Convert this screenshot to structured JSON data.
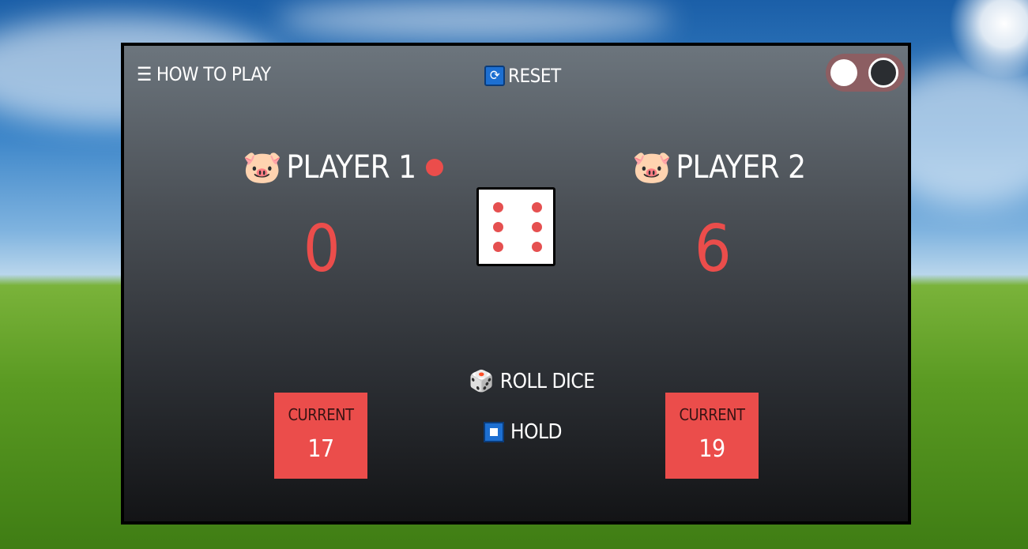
{
  "header": {
    "how_to_play_icon": "☰",
    "how_to_play": "HOW TO PLAY",
    "reset_icon": "🔄",
    "reset": "RESET"
  },
  "players": [
    {
      "icon": "🐷",
      "name": "PLAYER 1",
      "score": "0",
      "current_label": "CURRENT",
      "current": "17",
      "active": true
    },
    {
      "icon": "🐷",
      "name": "PLAYER 2",
      "score": "6",
      "current_label": "CURRENT",
      "current": "19",
      "active": false
    }
  ],
  "dice": {
    "value": 6
  },
  "controls": {
    "roll_icon": "🎲",
    "roll": "ROLL DICE",
    "hold": "HOLD"
  },
  "theme": {
    "accent": "#eb4d4b",
    "toggle_bg": "#8c5e62"
  }
}
